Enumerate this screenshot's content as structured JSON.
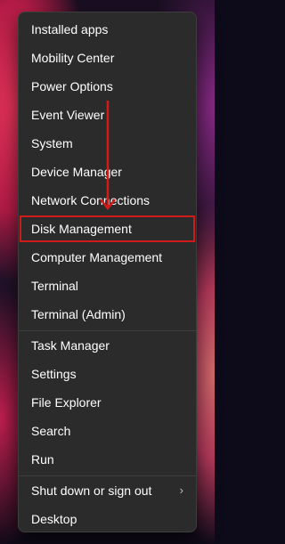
{
  "menu": {
    "group1": [
      "Installed apps",
      "Mobility Center",
      "Power Options",
      "Event Viewer",
      "System",
      "Device Manager",
      "Network Connections",
      "Disk Management",
      "Computer Management",
      "Terminal",
      "Terminal (Admin)"
    ],
    "group2": [
      "Task Manager",
      "Settings",
      "File Explorer",
      "Search",
      "Run"
    ],
    "group3": [
      "Shut down or sign out",
      "Desktop"
    ],
    "submenu_chevron": "›",
    "highlighted_item": "Disk Management"
  },
  "colors": {
    "menu_background": "#2b2b2b",
    "text": "#ffffff",
    "annotation_red": "#d11a1a"
  }
}
